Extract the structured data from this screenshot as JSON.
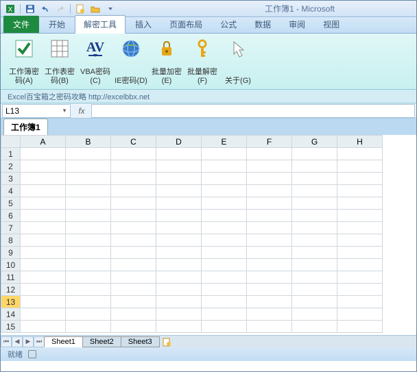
{
  "title": "工作簿1 - Microsoft",
  "tabs": {
    "file": "文件",
    "home": "开始",
    "tool": "解密工具",
    "insert": "插入",
    "layout": "页面布局",
    "formula": "公式",
    "data": "数据",
    "review": "审阅",
    "view": "视图"
  },
  "ribbon": {
    "b1": "工作簿密码(A)",
    "b2": "工作表密码(B)",
    "b3": "VBA密码(C)",
    "b4": "IE密码(D)",
    "b5": "批量加密(E)",
    "b6": "批量解密(F)",
    "b7": "关于(G)"
  },
  "ribbon_footer": "Excel百宝箱之密码攻略  http://excelbbx.net",
  "namebox": "L13",
  "fx": "fx",
  "workbook_tab": "工作簿1",
  "cols": [
    "A",
    "B",
    "C",
    "D",
    "E",
    "F",
    "G",
    "H"
  ],
  "rows": [
    "1",
    "2",
    "3",
    "4",
    "5",
    "6",
    "7",
    "8",
    "9",
    "10",
    "11",
    "12",
    "13",
    "14",
    "15"
  ],
  "selected_row": "13",
  "sheets": {
    "s1": "Sheet1",
    "s2": "Sheet2",
    "s3": "Sheet3"
  },
  "status": "就绪"
}
